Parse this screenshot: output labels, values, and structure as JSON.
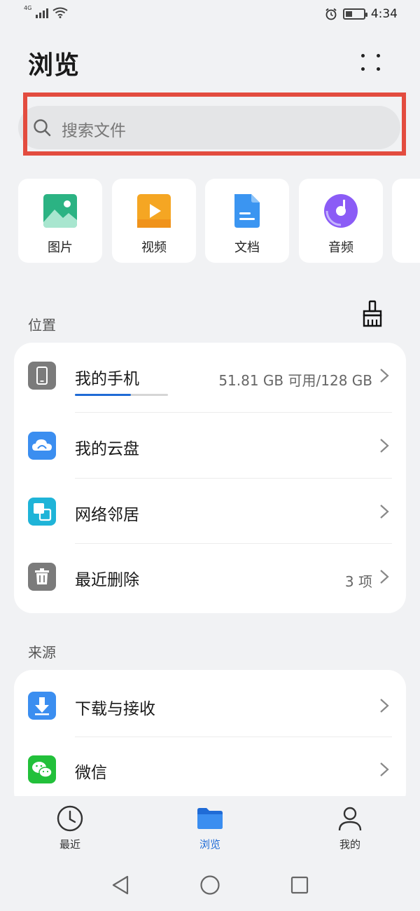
{
  "status_bar": {
    "network": "4G",
    "time": "4:34"
  },
  "header": {
    "title": "浏览"
  },
  "search": {
    "placeholder": "搜索文件"
  },
  "categories": [
    {
      "label": "图片",
      "icon": "image-icon",
      "color": "#2bb383"
    },
    {
      "label": "视频",
      "icon": "video-icon",
      "color": "#f5a623"
    },
    {
      "label": "文档",
      "icon": "document-icon",
      "color": "#3b95f1"
    },
    {
      "label": "音频",
      "icon": "audio-icon",
      "color": "#8b5cf6"
    }
  ],
  "locations": {
    "title": "位置",
    "items": [
      {
        "label": "我的手机",
        "value": "51.81 GB 可用/128 GB",
        "icon": "phone-icon",
        "storage_used_fraction": 0.6
      },
      {
        "label": "我的云盘",
        "value": "",
        "icon": "cloud-icon"
      },
      {
        "label": "网络邻居",
        "value": "",
        "icon": "network-neighbor-icon"
      },
      {
        "label": "最近删除",
        "value": "3 项",
        "icon": "trash-icon"
      }
    ]
  },
  "sources": {
    "title": "来源",
    "items": [
      {
        "label": "下载与接收",
        "icon": "download-icon"
      },
      {
        "label": "微信",
        "icon": "wechat-icon"
      }
    ]
  },
  "bottom_nav": {
    "items": [
      {
        "label": "最近",
        "icon": "clock-icon",
        "active": false
      },
      {
        "label": "浏览",
        "icon": "folder-icon",
        "active": true
      },
      {
        "label": "我的",
        "icon": "person-icon",
        "active": false
      }
    ]
  },
  "colors": {
    "accent": "#1f6bd6",
    "highlight": "#e34c3f"
  }
}
